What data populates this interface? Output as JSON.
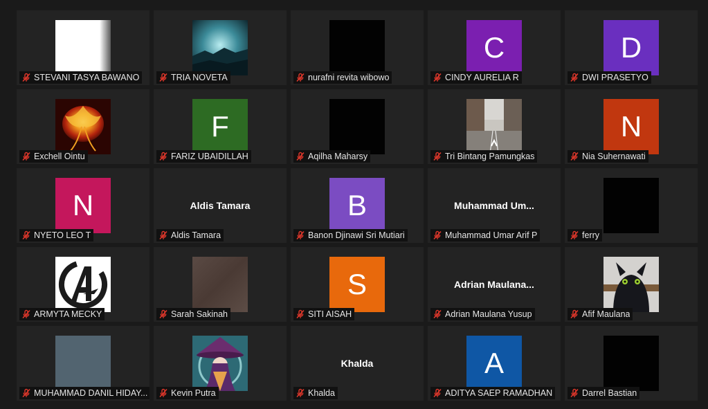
{
  "participants": [
    {
      "name": "STEVANI TASYA BAWANO",
      "avatar": {
        "type": "photo",
        "image": "white-blur"
      }
    },
    {
      "name": "TRIA NOVETA",
      "avatar": {
        "type": "photo",
        "image": "teal-landscape"
      }
    },
    {
      "name": "nurafni revita wibowo",
      "avatar": {
        "type": "photo",
        "image": "black"
      }
    },
    {
      "name": "CINDY AURELIA R",
      "avatar": {
        "type": "initial",
        "letter": "C",
        "color": "#7b1fb0"
      }
    },
    {
      "name": "DWI PRASETYO",
      "avatar": {
        "type": "initial",
        "letter": "D",
        "color": "#6a2fbf"
      }
    },
    {
      "name": "Exchell Ointu",
      "avatar": {
        "type": "photo",
        "image": "fire-flower"
      }
    },
    {
      "name": "FARIZ UBAIDILLAH",
      "avatar": {
        "type": "initial",
        "letter": "F",
        "color": "#2d6b23"
      }
    },
    {
      "name": "Aqilha Maharsy",
      "avatar": {
        "type": "photo",
        "image": "black"
      }
    },
    {
      "name": "Tri Bintang Pamungkas",
      "avatar": {
        "type": "photo",
        "image": "city-street"
      }
    },
    {
      "name": "Nia Suhernawati",
      "avatar": {
        "type": "initial",
        "letter": "N",
        "color": "#c1370f"
      }
    },
    {
      "name": "NYETO LEO T",
      "avatar": {
        "type": "initial",
        "letter": "N",
        "color": "#c4175c"
      }
    },
    {
      "name": "Aldis Tamara",
      "avatar": {
        "type": "text",
        "label": "Aldis Tamara"
      }
    },
    {
      "name": "Banon Djinawi Sri Mutiari",
      "avatar": {
        "type": "initial",
        "letter": "B",
        "color": "#7b4cc2"
      }
    },
    {
      "name": "Muhammad Umar Arif P",
      "avatar": {
        "type": "text",
        "label": "Muhammad  Um..."
      }
    },
    {
      "name": "ferry",
      "avatar": {
        "type": "photo",
        "image": "black"
      }
    },
    {
      "name": "ARMYTA MECKY",
      "avatar": {
        "type": "photo",
        "image": "avengers-logo"
      }
    },
    {
      "name": "Sarah Sakinah",
      "avatar": {
        "type": "photo",
        "image": "brown-blur"
      }
    },
    {
      "name": "SITI AISAH",
      "avatar": {
        "type": "initial",
        "letter": "S",
        "color": "#e8690c"
      }
    },
    {
      "name": "Adrian Maulana Yusup",
      "avatar": {
        "type": "text",
        "label": "Adrian  Maulana..."
      }
    },
    {
      "name": "Afif Maulana",
      "avatar": {
        "type": "photo",
        "image": "night-fury"
      }
    },
    {
      "name": "MUHAMMAD DANIL HIDAY...",
      "avatar": {
        "type": "photo",
        "image": "grey-blur"
      }
    },
    {
      "name": "Kevin Putra",
      "avatar": {
        "type": "photo",
        "image": "anime-witch"
      }
    },
    {
      "name": "Khalda",
      "avatar": {
        "type": "text",
        "label": "Khalda"
      }
    },
    {
      "name": "ADITYA SAEP RAMADHAN",
      "avatar": {
        "type": "initial",
        "letter": "A",
        "color": "#0f57a5"
      }
    },
    {
      "name": "Darrel Bastian",
      "avatar": {
        "type": "photo",
        "image": "black"
      }
    }
  ],
  "icons": {
    "mute": "microphone-muted-icon"
  },
  "colors": {
    "background": "#1a1a1a",
    "tile": "#232323",
    "mute": "#e0372b"
  }
}
